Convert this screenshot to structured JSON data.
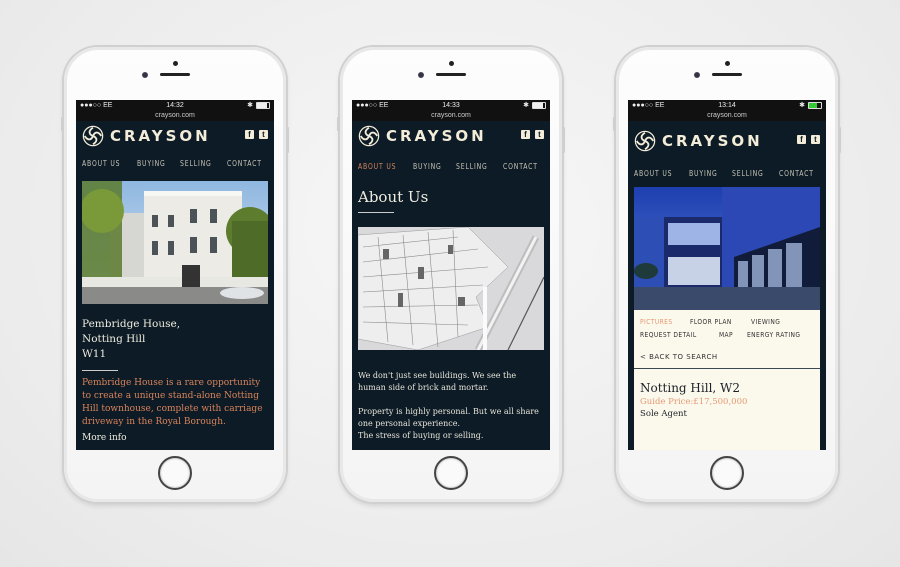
{
  "brand": {
    "name": "CRAYSON",
    "social": [
      "f",
      "t"
    ],
    "accent": "#d9845c",
    "background": "#0c1b26"
  },
  "phones": [
    {
      "status": {
        "carrier": "●●●○○ EE",
        "time": "14:32",
        "battery": 0.8
      },
      "url": "crayson.com",
      "nav": [
        "ABOUT US",
        "BUYING",
        "SELLING",
        "CONTACT"
      ],
      "active_nav": null,
      "listing": {
        "title_lines": [
          "Pembridge House,",
          "Notting Hill",
          "W11"
        ],
        "description": "Pembridge House is a rare opportunity to create a unique stand-alone Notting Hill townhouse, complete with carriage driveway in the Royal Borough.",
        "more": "More info"
      }
    },
    {
      "status": {
        "carrier": "●●●○○ EE",
        "time": "14:33",
        "battery": 0.8
      },
      "url": "crayson.com",
      "nav": [
        "ABOUT US",
        "BUYING",
        "SELLING",
        "CONTACT"
      ],
      "active_nav": "ABOUT US",
      "page": {
        "heading": "About Us",
        "paragraph1": "We don't just see buildings. We see the human side of brick and mortar.",
        "paragraph2_lines": [
          "Property is highly personal. But we all share one personal experience.",
          "The stress of buying or selling."
        ]
      }
    },
    {
      "status": {
        "carrier": "●●●○○ EE",
        "time": "13:14",
        "battery": 0.7
      },
      "url": "crayson.com",
      "nav": [
        "ABOUT US",
        "BUYING",
        "SELLING",
        "CONTACT"
      ],
      "active_nav": null,
      "detail": {
        "tabs": [
          "PICTURES",
          "FLOOR PLAN",
          "VIEWING",
          "REQUEST DETAIL",
          "MAP",
          "ENERGY RATING"
        ],
        "active_tab": "PICTURES",
        "back": "< BACK TO SEARCH",
        "title": "Notting Hill, W2",
        "price": "Guide Price:£17,500,000",
        "agent": "Sole Agent"
      }
    }
  ]
}
